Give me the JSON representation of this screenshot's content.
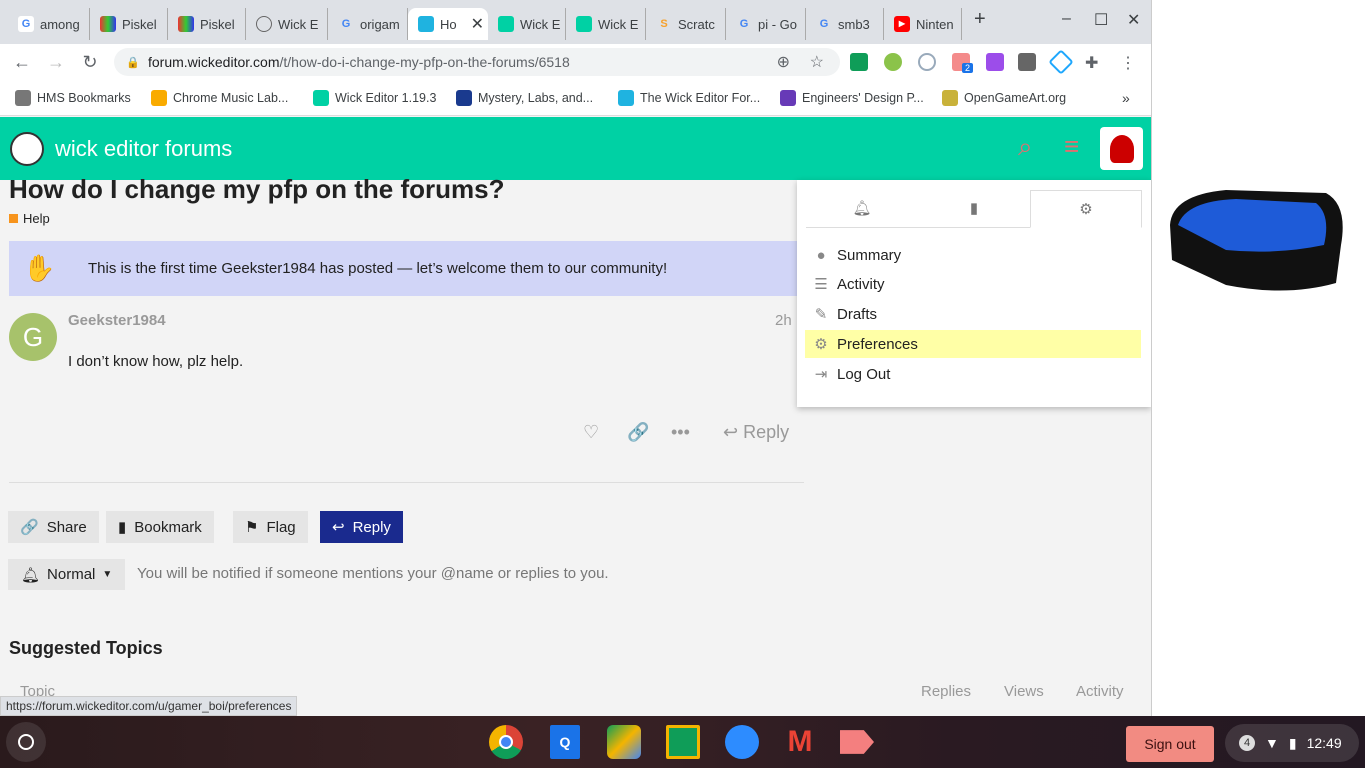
{
  "browser": {
    "tabs": [
      {
        "label": "among",
        "icon": "google-icon"
      },
      {
        "label": "Piskel",
        "icon": "piskel-icon"
      },
      {
        "label": "Piskel",
        "icon": "piskel-icon"
      },
      {
        "label": "Wick E",
        "icon": "wick-icon"
      },
      {
        "label": "origam",
        "icon": "google-icon"
      },
      {
        "label": "Ho",
        "icon": "wick-forum-icon",
        "active": true
      },
      {
        "label": "Wick E",
        "icon": "wick-icon"
      },
      {
        "label": "Wick E",
        "icon": "wick-icon"
      },
      {
        "label": "Scratc",
        "icon": "scratch-icon"
      },
      {
        "label": "pi - Go",
        "icon": "google-icon"
      },
      {
        "label": "smb3",
        "icon": "google-icon"
      },
      {
        "label": "Ninten",
        "icon": "youtube-icon"
      }
    ],
    "url_domain": "forum.wickeditor.com",
    "url_path": "/t/how-do-i-change-my-pfp-on-the-forums/6518",
    "bookmarks": [
      "HMS Bookmarks",
      "Chrome Music Lab...",
      "Wick Editor 1.19.3",
      "Mystery, Labs, and...",
      "The Wick Editor For...",
      "Engineers' Design P...",
      "OpenGameArt.org"
    ],
    "extension_badge": "2",
    "status_url": "https://forum.wickeditor.com/u/gamer_boi/preferences"
  },
  "forum": {
    "site_title": "wick editor forums",
    "accent": "#00d1a4",
    "topic_title": "How do I change my pfp on the forums?",
    "category": "Help",
    "welcome": "This is the first time Geekster1984 has posted — let’s welcome them to our community!",
    "post": {
      "avatar_letter": "G",
      "username": "Geekster1984",
      "time": "2h",
      "body": "I don’t know how, plz help.",
      "reply": "Reply"
    },
    "actions": {
      "share": "Share",
      "bookmark": "Bookmark",
      "flag": "Flag",
      "reply": "Reply"
    },
    "notification": {
      "level": "Normal",
      "text": "You will be notified if someone mentions your @name or replies to you."
    },
    "suggested": {
      "title": "Suggested Topics",
      "columns": [
        "Topic",
        "Replies",
        "Views",
        "Activity"
      ]
    }
  },
  "user_menu": {
    "items": [
      {
        "label": "Summary",
        "icon": "user-icon"
      },
      {
        "label": "Activity",
        "icon": "list-icon"
      },
      {
        "label": "Drafts",
        "icon": "pencil-icon"
      },
      {
        "label": "Preferences",
        "icon": "gear-icon",
        "highlighted": true
      },
      {
        "label": "Log Out",
        "icon": "sign-out-icon"
      }
    ]
  },
  "shelf": {
    "sign_out": "Sign out",
    "notifications": "4",
    "time": "12:49"
  }
}
